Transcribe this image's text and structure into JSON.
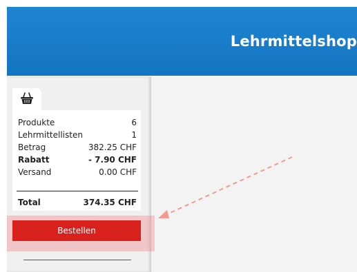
{
  "header": {
    "title": "Lehrmittelshop"
  },
  "cart": {
    "icon": "basket-icon",
    "rows": [
      {
        "label": "Produkte",
        "value": "6"
      },
      {
        "label": "Lehrmittellisten",
        "value": "1"
      },
      {
        "label": "Betrag",
        "value": "382.25 CHF"
      },
      {
        "label": "Rabatt",
        "value": "- 7.90 CHF"
      },
      {
        "label": "Versand",
        "value": "0.00 CHF"
      }
    ],
    "total": {
      "label": "Total",
      "value": "374.35 CHF"
    },
    "order_button": "Bestellen"
  },
  "colors": {
    "header": "#1f84d2",
    "order_button": "#d8201d",
    "highlight": "#f07878"
  }
}
